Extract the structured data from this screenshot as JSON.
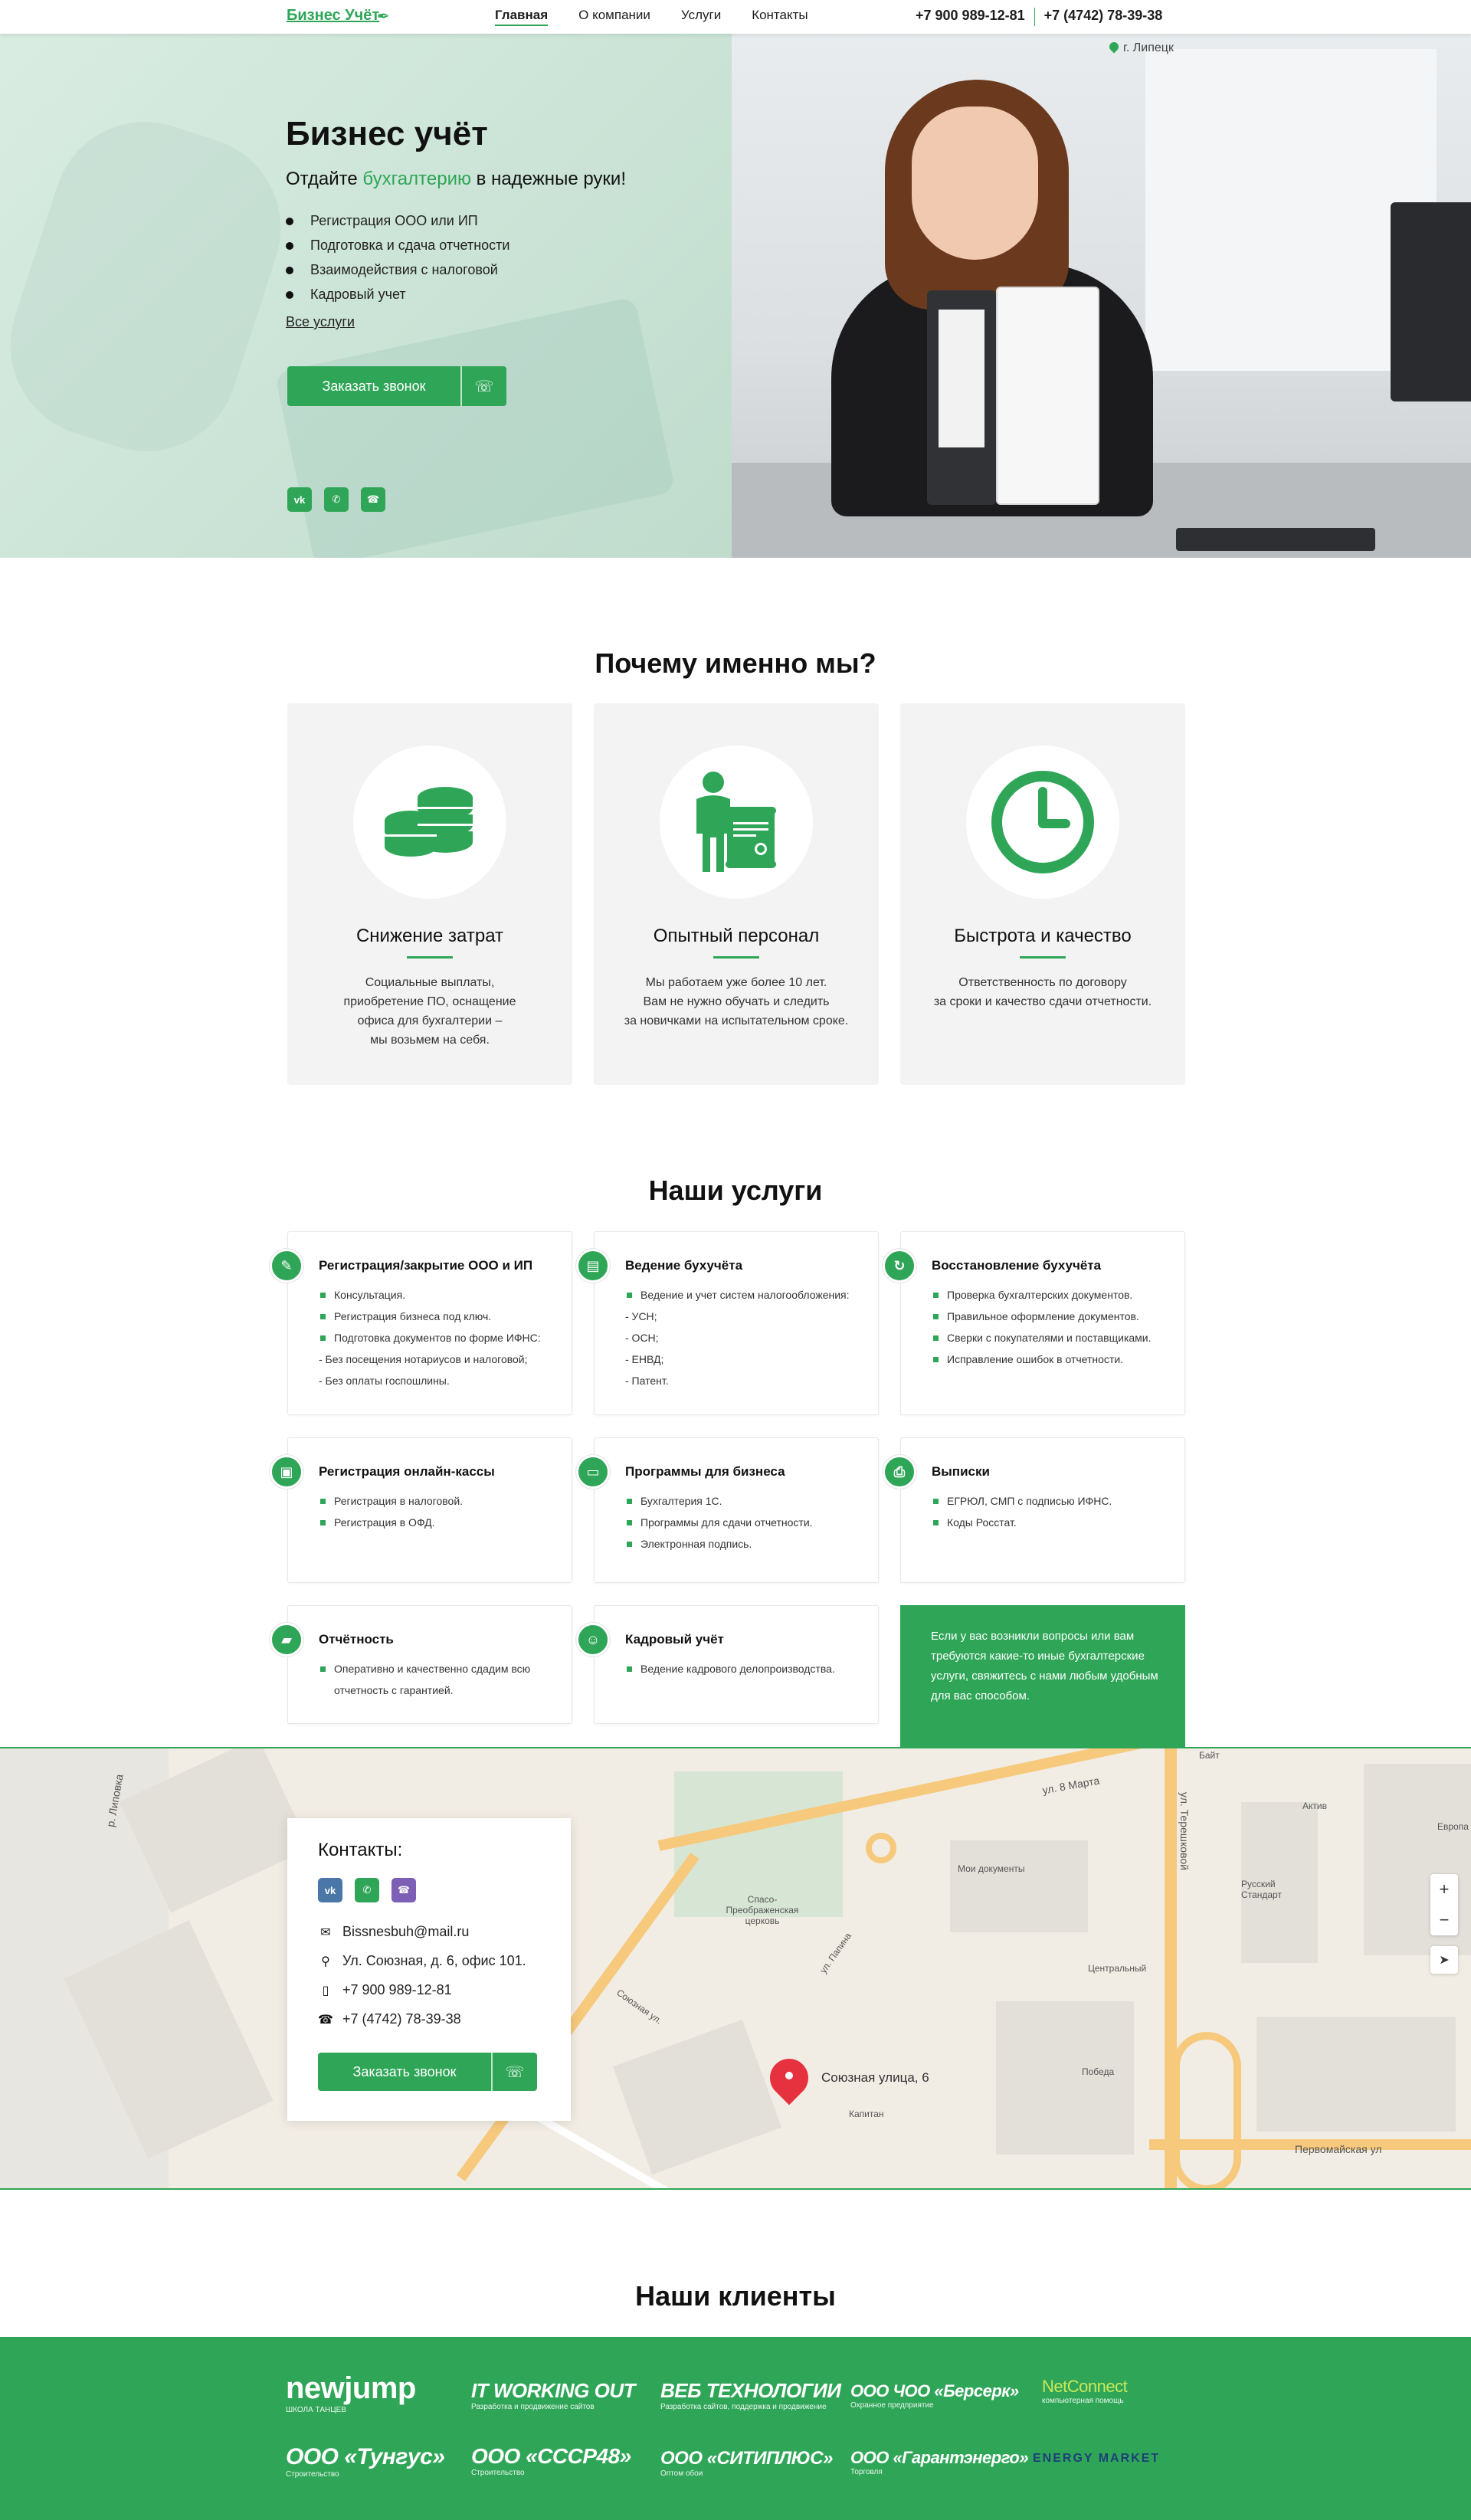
{
  "header": {
    "logo": "Бизнес Учёт",
    "nav": [
      "Главная",
      "О компании",
      "Услуги",
      "Контакты"
    ],
    "phone1": "+7 900 989-12-81",
    "phone2": "+7 (4742) 78-39-38"
  },
  "hero": {
    "location": "г. Липецк",
    "title": "Бизнес учёт",
    "sub_before": "Отдайте ",
    "sub_highlight": "бухгалтерию",
    "sub_after": " в надежные руки!",
    "list": [
      "Регистрация ООО или ИП",
      "Подготовка и сдача отчетности",
      "Взаимодействия с налоговой",
      "Кадровый учет"
    ],
    "all_services": "Все услуги",
    "cta": "Заказать звонок"
  },
  "why": {
    "title": "Почему именно мы?",
    "cards": [
      {
        "title": "Снижение затрат",
        "text": "Социальные выплаты,\nприобретение ПО, оснащение\nофиса для бухгалтерии –\nмы возьмем на себя.",
        "icon": "coins-icon"
      },
      {
        "title": "Опытный персонал",
        "text": "Мы работаем уже более 10 лет.\nВам не нужно обучать и следить\nза новичками на испытательном сроке.",
        "icon": "employee-icon"
      },
      {
        "title": "Быстрота и качество",
        "text": "Ответственность по договору\nза сроки и качество сдачи отчетности.",
        "icon": "clock-icon"
      }
    ]
  },
  "services": {
    "title": "Наши услуги",
    "cards": [
      {
        "title": "Регистрация/закрытие ООО и ИП",
        "items": [
          "Консультация.",
          "Регистрация бизнеса под ключ.",
          "Подготовка документов по форме ИФНС:"
        ],
        "dashes": [
          "- Без посещения нотариусов и налоговой;",
          "- Без оплаты госпошлины."
        ]
      },
      {
        "title": "Ведение бухучёта",
        "items": [
          "Ведение и учет систем налогообложения:"
        ],
        "dashes": [
          "- УСН;",
          "- ОСН;",
          "- ЕНВД;",
          "- Патент."
        ]
      },
      {
        "title": "Восстановление бухучёта",
        "items": [
          "Проверка бухгалтерских документов.",
          "Правильное оформление документов.",
          "Сверки с покупателями и поставщиками.",
          "Исправление ошибок в отчетности."
        ],
        "dashes": []
      },
      {
        "title": "Регистрация онлайн-кассы",
        "items": [
          "Регистрация в налоговой.",
          "Регистрация в ОФД."
        ],
        "dashes": []
      },
      {
        "title": "Программы для бизнеса",
        "items": [
          "Бухгалтерия 1С.",
          "Программы для сдачи отчетности.",
          "Электронная подпись."
        ],
        "dashes": []
      },
      {
        "title": "Выписки",
        "items": [
          "ЕГРЮЛ, СМП с подписью ИФНС.",
          "Коды Росстат."
        ],
        "dashes": []
      },
      {
        "title": "Отчётность",
        "items": [
          "Оперативно и качественно сдадим всю отчетность с гарантией."
        ],
        "dashes": []
      },
      {
        "title": "Кадровый учёт",
        "items": [
          "Ведение кадрового делопроизводства."
        ],
        "dashes": []
      }
    ],
    "note": "Если у вас возникли вопросы или вам требуются какие-то иные бухгалтерские услуги, свяжитесь с нами любым удобным для вас способом."
  },
  "contacts": {
    "title": "Контакты:",
    "email": "Bissnesbuh@mail.ru",
    "address": "Ул. Союзная, д. 6, офис 101.",
    "phone1": "+7 900 989-12-81",
    "phone2": "+7 (4742) 78-39-38",
    "cta": "Заказать звонок"
  },
  "map": {
    "pin_label": "Союзная улица, 6",
    "labels": [
      "ул. 8 Марта",
      "Первомайская ул",
      "Спасо-Преображенская церковь",
      "Мои документы",
      "Центральный",
      "Победа",
      "Капитан",
      "Русский Стандарт",
      "Актив",
      "Европа",
      "Байт",
      "Союзная ул.",
      "ул. Папина",
      "р. Липовка",
      "ул. Терешковой"
    ]
  },
  "clients": {
    "title": "Наши клиенты",
    "row1": [
      {
        "name": "newjump",
        "sub": "ШКОЛА ТАНЦЕВ"
      },
      {
        "name": "IT WORKING OUT",
        "sub": "Разработка и продвижение сайтов"
      },
      {
        "name": "ВЕБ ТЕХНОЛОГИИ",
        "sub": "Разработка сайтов, поддержка и продвижение"
      },
      {
        "name": "ООО ЧОО «Берсерк»",
        "sub": "Охранное предприятие"
      },
      {
        "name": "NetConnect",
        "sub": "компьютерная помощь"
      }
    ],
    "row2": [
      {
        "name": "ООО «Тунгус»",
        "sub": "Строительство"
      },
      {
        "name": "ООО «СССР48»",
        "sub": "Строительство"
      },
      {
        "name": "ООО «СИТИПЛЮС»",
        "sub": "Оптом обои"
      },
      {
        "name": "ООО «Гарантэнерго»",
        "sub": "Торговля"
      },
      {
        "name": "ENERGY MARKET",
        "sub": ""
      }
    ]
  },
  "colors": {
    "accent": "#2fa657"
  }
}
